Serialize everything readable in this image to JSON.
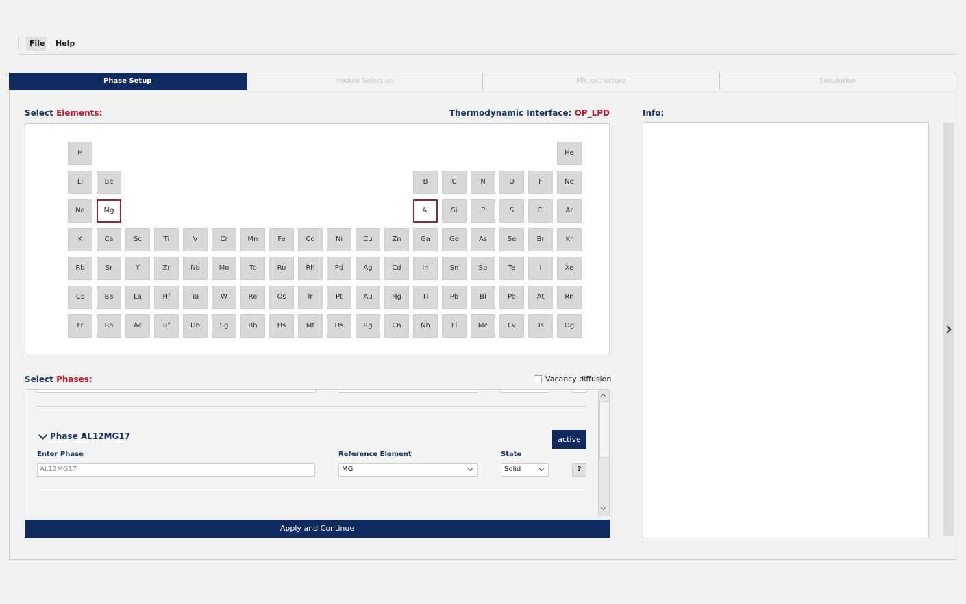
{
  "menu": {
    "file": "File",
    "help": "Help"
  },
  "tabs": [
    "Phase Setup",
    "Module Selection",
    "Microstructure",
    "Simulation"
  ],
  "elements_section": {
    "title_prefix": "Select ",
    "title_accent": "Elements:",
    "thermo_prefix": "Thermodynamic Interface: ",
    "thermo_value": "OP_LPD",
    "selected": [
      "Mg",
      "Al"
    ],
    "rows": [
      [
        "H",
        "",
        "",
        "",
        "",
        "",
        "",
        "",
        "",
        "",
        "",
        "",
        "",
        "",
        "",
        "",
        "",
        "He"
      ],
      [
        "Li",
        "Be",
        "",
        "",
        "",
        "",
        "",
        "",
        "",
        "",
        "",
        "",
        "B",
        "C",
        "N",
        "O",
        "F",
        "Ne"
      ],
      [
        "Na",
        "Mg",
        "",
        "",
        "",
        "",
        "",
        "",
        "",
        "",
        "",
        "",
        "Al",
        "Si",
        "P",
        "S",
        "Cl",
        "Ar"
      ],
      [
        "K",
        "Ca",
        "Sc",
        "Ti",
        "V",
        "Cr",
        "Mn",
        "Fe",
        "Co",
        "Ni",
        "Cu",
        "Zn",
        "Ga",
        "Ge",
        "As",
        "Se",
        "Br",
        "Kr"
      ],
      [
        "Rb",
        "Sr",
        "Y",
        "Zr",
        "Nb",
        "Mo",
        "Tc",
        "Ru",
        "Rh",
        "Pd",
        "Ag",
        "Cd",
        "In",
        "Sn",
        "Sb",
        "Te",
        "I",
        "Xe"
      ],
      [
        "Cs",
        "Ba",
        "La",
        "Hf",
        "Ta",
        "W",
        "Re",
        "Os",
        "Ir",
        "Pt",
        "Au",
        "Hg",
        "Tl",
        "Pb",
        "Bi",
        "Po",
        "At",
        "Rn"
      ],
      [
        "Fr",
        "Ra",
        "Ac",
        "Rf",
        "Db",
        "Sg",
        "Bh",
        "Hs",
        "Mt",
        "Ds",
        "Rg",
        "Cn",
        "Nh",
        "Fl",
        "Mc",
        "Lv",
        "Ts",
        "Og"
      ]
    ]
  },
  "phases_section": {
    "title_prefix": "Select ",
    "title_accent": "Phases:",
    "vacancy_label": "Vacancy diffusion",
    "phase_name": "Phase AL12MG17",
    "active_label": "active",
    "enter_phase_label": "Enter Phase",
    "enter_phase_value": "AL12MG17",
    "reference_element_label": "Reference Element",
    "reference_element_value": "MG",
    "state_label": "State",
    "state_value": "Solid",
    "help_label": "?"
  },
  "apply_label": "Apply and Continue",
  "info": {
    "title": "Info:"
  }
}
